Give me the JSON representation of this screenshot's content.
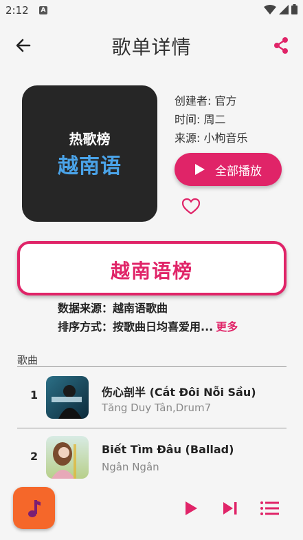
{
  "status_bar": {
    "time": "2:12"
  },
  "header": {
    "title": "歌单详情"
  },
  "cover": {
    "line1": "热歌榜",
    "line2": "越南语"
  },
  "meta": {
    "creator": "创建者: 官方",
    "time": "时间: 周二",
    "source": "来源: 小枸音乐"
  },
  "play_all": {
    "label": "全部播放"
  },
  "banner": {
    "title": "越南语榜"
  },
  "info": {
    "data_source": "数据来源：越南语歌曲",
    "sort_method": "排序方式：按歌曲日均喜爱用...",
    "more": "更多"
  },
  "section": {
    "label": "歌曲"
  },
  "songs": [
    {
      "index": "1",
      "title": "伤心剖半 (Cắt Đôi Nỗi Sầu)",
      "artist": "Tăng Duy Tân,Drum7"
    },
    {
      "index": "2",
      "title": "Biết Tìm Đâu (Ballad)",
      "artist": "Ngân Ngân"
    }
  ],
  "colors": {
    "accent": "#e02468",
    "cover_bg": "#262626",
    "cover_text_blue": "#4aa3e8",
    "mini_cover": "#f5672a"
  },
  "icons": [
    "back-arrow-icon",
    "share-icon",
    "play-icon",
    "heart-outline-icon",
    "music-note-icon",
    "skip-next-icon",
    "playlist-icon"
  ]
}
